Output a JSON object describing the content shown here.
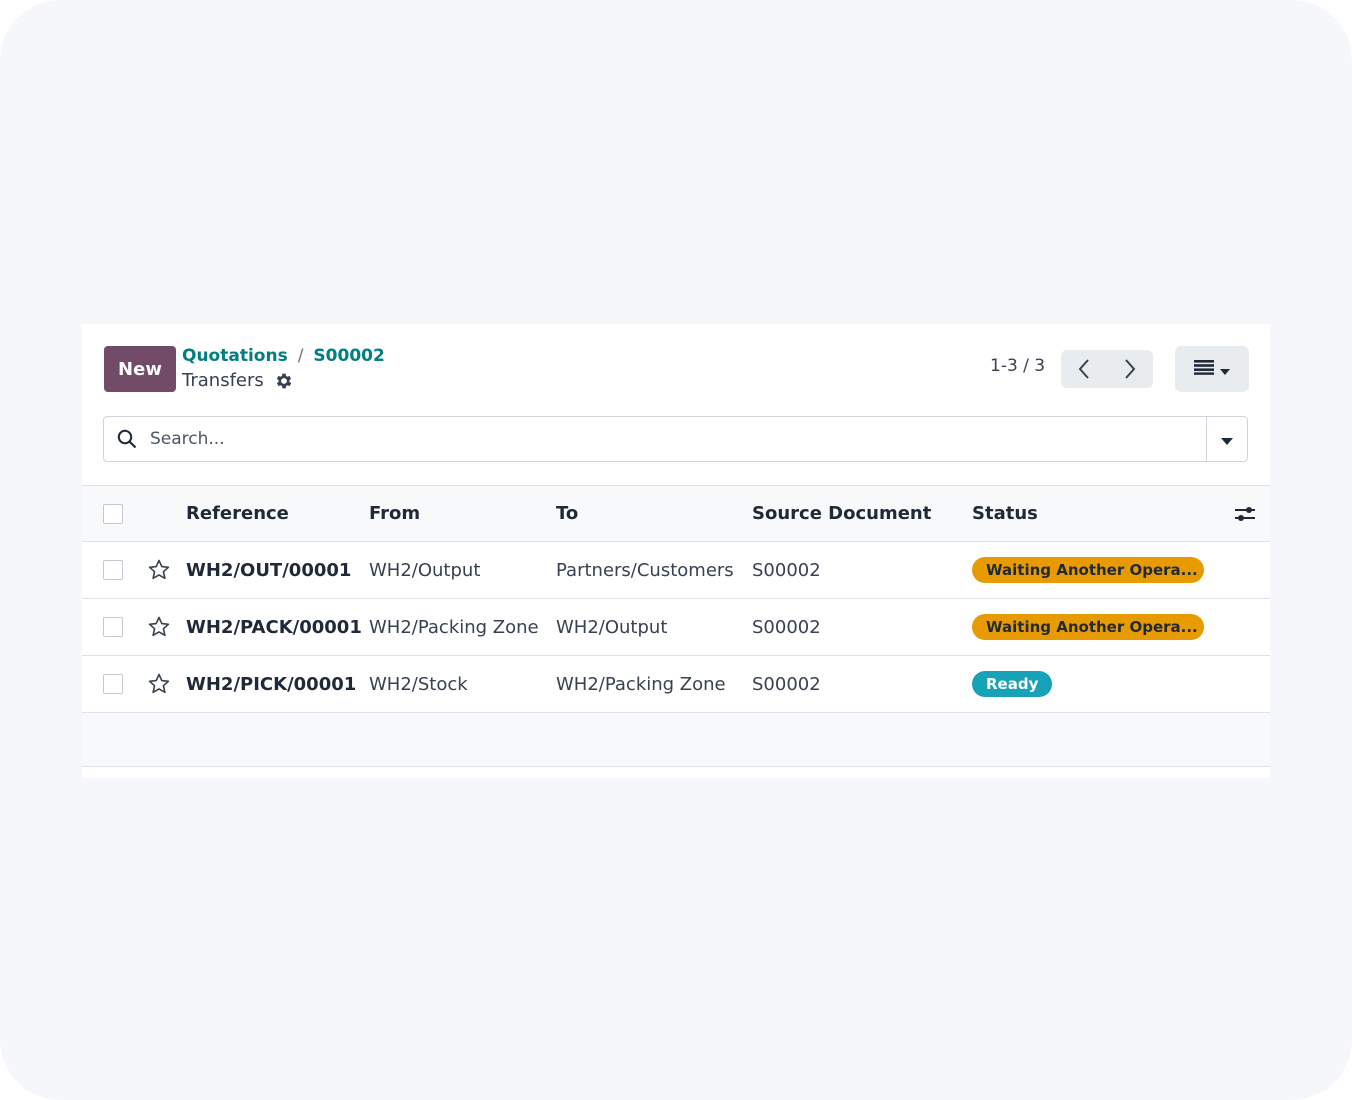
{
  "control_panel": {
    "new_label": "New",
    "breadcrumb": [
      {
        "label": "Quotations"
      },
      {
        "label": "S00002"
      }
    ],
    "breadcrumb_separator": "/",
    "title": "Transfers",
    "pager_value": "1-3 / 3"
  },
  "search": {
    "placeholder": "Search..."
  },
  "table": {
    "columns": [
      "Reference",
      "From",
      "To",
      "Source Document",
      "Status"
    ],
    "rows": [
      {
        "reference": "WH2/OUT/00001",
        "from": "WH2/Output",
        "to": "Partners/Customers",
        "source": "S00002",
        "status": "Waiting Another Opera...",
        "status_kind": "warning"
      },
      {
        "reference": "WH2/PACK/00001",
        "from": "WH2/Packing Zone",
        "to": "WH2/Output",
        "source": "S00002",
        "status": "Waiting Another Opera...",
        "status_kind": "warning"
      },
      {
        "reference": "WH2/PICK/00001",
        "from": "WH2/Stock",
        "to": "WH2/Packing Zone",
        "source": "S00002",
        "status": "Ready",
        "status_kind": "ready"
      }
    ]
  },
  "colors": {
    "primary": "#714b67",
    "link": "#017e84",
    "warning": "#e89b00",
    "ready": "#17a2b8"
  },
  "icons": {
    "settings": "gear-icon",
    "search": "search-icon",
    "pager_prev": "chevron-left-icon",
    "pager_next": "chevron-right-icon",
    "view": "list-view-icon",
    "favorite": "star-icon",
    "optional_columns": "sliders-icon"
  }
}
